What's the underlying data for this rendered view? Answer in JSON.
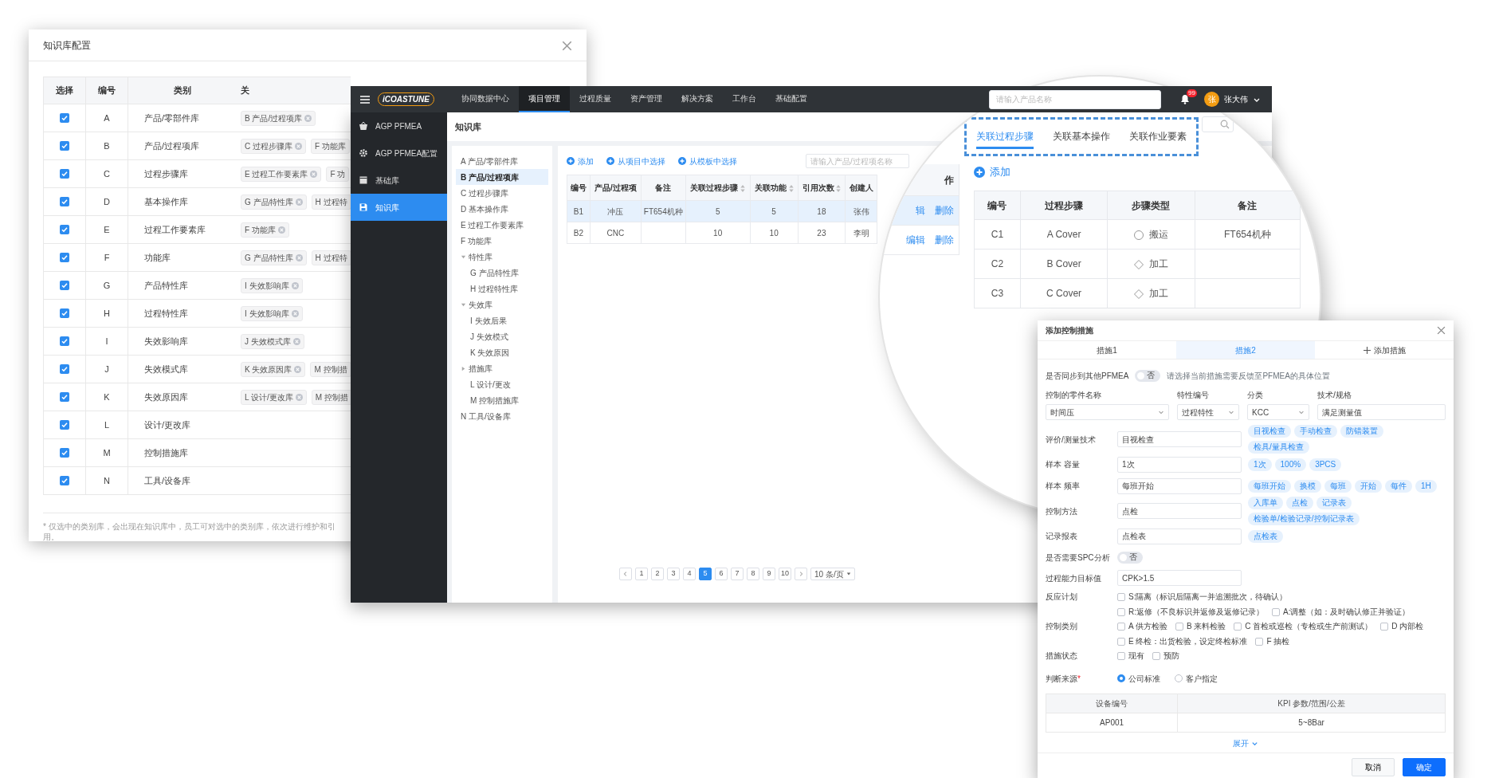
{
  "config_dialog": {
    "title": "知识库配置",
    "columns": [
      "选择",
      "编号",
      "类别",
      "关"
    ],
    "rows": [
      {
        "checked": true,
        "code": "A",
        "category": "产品/零部件库",
        "links": [
          {
            "label": "B 产品/过程项库",
            "removable": true
          }
        ]
      },
      {
        "checked": true,
        "code": "B",
        "category": "产品/过程项库",
        "links": [
          {
            "label": "C 过程步骤库",
            "removable": true
          },
          {
            "label": "F 功能库",
            "removable": false
          }
        ]
      },
      {
        "checked": true,
        "code": "C",
        "category": "过程步骤库",
        "links": [
          {
            "label": "E 过程工作要素库",
            "removable": true
          },
          {
            "label": "F 功",
            "removable": false
          }
        ]
      },
      {
        "checked": true,
        "code": "D",
        "category": "基本操作库",
        "links": [
          {
            "label": "G 产品特性库",
            "removable": true
          },
          {
            "label": "H 过程特",
            "removable": false
          }
        ]
      },
      {
        "checked": true,
        "code": "E",
        "category": "过程工作要素库",
        "links": [
          {
            "label": "F 功能库",
            "removable": true
          }
        ]
      },
      {
        "checked": true,
        "code": "F",
        "category": "功能库",
        "links": [
          {
            "label": "G 产品特性库",
            "removable": true
          },
          {
            "label": "H 过程特",
            "removable": false
          }
        ]
      },
      {
        "checked": true,
        "code": "G",
        "category": "产品特性库",
        "links": [
          {
            "label": "I 失效影响库",
            "removable": true
          }
        ]
      },
      {
        "checked": true,
        "code": "H",
        "category": "过程特性库",
        "links": [
          {
            "label": "I 失效影响库",
            "removable": true
          }
        ]
      },
      {
        "checked": true,
        "code": "I",
        "category": "失效影响库",
        "links": [
          {
            "label": "J 失效模式库",
            "removable": true
          }
        ]
      },
      {
        "checked": true,
        "code": "J",
        "category": "失效模式库",
        "links": [
          {
            "label": "K 失效原因库",
            "removable": true
          },
          {
            "label": "M 控制措",
            "removable": false
          }
        ]
      },
      {
        "checked": true,
        "code": "K",
        "category": "失效原因库",
        "links": [
          {
            "label": "L 设计/更改库",
            "removable": true
          },
          {
            "label": "M 控制措",
            "removable": false
          }
        ]
      },
      {
        "checked": true,
        "code": "L",
        "category": "设计/更改库"
      },
      {
        "checked": true,
        "code": "M",
        "category": "控制措施库"
      },
      {
        "checked": true,
        "code": "N",
        "category": "工具/设备库"
      }
    ],
    "footnote": "* 仅选中的类别库，会出现在知识库中，员工可对选中的类别库，依次进行维护和引用。"
  },
  "app": {
    "logo": "iCOASTUNE",
    "nav": [
      {
        "label": "协同数据中心",
        "selected": false
      },
      {
        "label": "项目管理",
        "selected": true
      },
      {
        "label": "过程质量",
        "selected": false
      },
      {
        "label": "资产管理",
        "selected": false
      },
      {
        "label": "解决方案",
        "selected": false
      },
      {
        "label": "工作台",
        "selected": false
      },
      {
        "label": "基础配置",
        "selected": false
      }
    ],
    "search": {
      "placeholder": "请输入产品名称"
    },
    "notifications": "99",
    "user": {
      "avatar": "张",
      "name": "张大伟"
    },
    "sidebar": [
      {
        "label": "AGP PFMEA",
        "selected": false
      },
      {
        "label": "AGP PFMEA配置",
        "selected": false
      },
      {
        "label": "基础库",
        "selected": false
      },
      {
        "label": "知识库",
        "selected": true
      }
    ],
    "page_title": "知识库",
    "tree": [
      {
        "label": "A 产品/零部件库",
        "selected": false
      },
      {
        "label": "B 产品/过程项库",
        "selected": true
      },
      {
        "label": "C 过程步骤库",
        "selected": false
      },
      {
        "label": "D 基本操作库",
        "selected": false
      },
      {
        "label": "E 过程工作要素库",
        "selected": false
      },
      {
        "label": "F 功能库",
        "selected": false
      },
      {
        "label": "特性库",
        "selected": false,
        "expanded": true,
        "children": [
          {
            "label": "G 产品特性库",
            "selected": false
          },
          {
            "label": "H 过程特性库",
            "selected": false
          }
        ]
      },
      {
        "label": "失效库",
        "selected": false,
        "expanded": true,
        "children": [
          {
            "label": "I 失效后果",
            "selected": false
          },
          {
            "label": "J 失效模式",
            "selected": false
          },
          {
            "label": "K 失效原因",
            "selected": false
          }
        ]
      },
      {
        "label": "措施库",
        "selected": false,
        "expanded": false,
        "children": [
          {
            "label": "L 设计/更改",
            "selected": false
          },
          {
            "label": "M 控制措施库",
            "selected": false
          }
        ]
      },
      {
        "label": "N 工具/设备库",
        "selected": false
      }
    ],
    "toolbar": [
      "添加",
      "从项目中选择",
      "从模板中选择"
    ],
    "table_search": {
      "placeholder": "请输入产品/过程项名称"
    },
    "table": {
      "columns": [
        {
          "label": "编号",
          "sortable": false
        },
        {
          "label": "产品/过程项",
          "sortable": false
        },
        {
          "label": "备注",
          "sortable": false
        },
        {
          "label": "关联过程步骤",
          "sortable": true
        },
        {
          "label": "关联功能",
          "sortable": true
        },
        {
          "label": "引用次数",
          "sortable": true
        },
        {
          "label": "创建人",
          "sortable": false
        }
      ],
      "rows": [
        {
          "selected": true,
          "cells": [
            "B1",
            "冲压",
            "FT654机种",
            "5",
            "5",
            "18",
            "张伟"
          ]
        },
        {
          "selected": false,
          "cells": [
            "B2",
            "CNC",
            "",
            "10",
            "10",
            "23",
            "李明"
          ]
        }
      ]
    },
    "pagination": {
      "pages": [
        {
          "label": "1",
          "selected": false
        },
        {
          "label": "2",
          "selected": false
        },
        {
          "label": "3",
          "selected": false
        },
        {
          "label": "4",
          "selected": false
        },
        {
          "label": "5",
          "selected": true
        },
        {
          "label": "6",
          "selected": false
        },
        {
          "label": "7",
          "selected": false
        },
        {
          "label": "8",
          "selected": false
        },
        {
          "label": "9",
          "selected": false
        },
        {
          "label": "10",
          "selected": false
        }
      ],
      "page_size": "10 条/页"
    }
  },
  "magnifier": {
    "left_table": {
      "header": "作",
      "rows": [
        [
          "辑",
          "删除"
        ],
        [
          "编辑",
          "删除"
        ]
      ]
    },
    "tabs": [
      {
        "label": "关联过程步骤",
        "selected": true
      },
      {
        "label": "关联基本操作",
        "selected": false
      },
      {
        "label": "关联作业要素",
        "selected": false
      }
    ],
    "add": "添加",
    "table": {
      "columns": [
        "编号",
        "过程步骤",
        "步骤类型",
        "备注"
      ],
      "rows": [
        {
          "code": "C1",
          "step": "A Cover",
          "type": {
            "kind": "circle",
            "label": "搬运"
          },
          "note": "FT654机种"
        },
        {
          "code": "C2",
          "step": "B Cover",
          "type": {
            "kind": "diamond",
            "label": "加工"
          }
        },
        {
          "code": "C3",
          "step": "C Cover",
          "type": {
            "kind": "diamond",
            "label": "加工"
          }
        }
      ]
    }
  },
  "control_dialog": {
    "title": "添加控制措施",
    "tabs": [
      {
        "label": "措施1",
        "selected": false
      },
      {
        "label": "措施2",
        "selected": true
      }
    ],
    "add_tab": "添加措施",
    "sync": {
      "label": "是否同步到其他PFMEA",
      "on": false,
      "switch_text": "否",
      "hint": "请选择当前措施需要反馈至PFMEA的具体位置"
    },
    "selects": [
      {
        "label": "控制的零件名称",
        "value": "时间压",
        "kind": "select"
      },
      {
        "label": "特性编号",
        "value": "过程特性",
        "kind": "select"
      },
      {
        "label": "分类",
        "value": "KCC",
        "kind": "select"
      },
      {
        "label": "技术/规格",
        "value": "满足测量值",
        "kind": "input"
      }
    ],
    "fields": [
      {
        "label": "评价/测量技术",
        "value": "目视检查",
        "chips": [
          "目视检查",
          "手动检查",
          "防错装置",
          "检具/量具检查"
        ]
      },
      {
        "label": "样本 容量",
        "value": "1次",
        "chips": [
          "1次",
          "100%",
          "3PCS"
        ]
      },
      {
        "label": "样本 频率",
        "value": "每班开始",
        "chips": [
          "每班开始",
          "换模",
          "每班",
          "开始",
          "每件",
          "1H"
        ]
      },
      {
        "label": "控制方法",
        "value": "点检",
        "chips": [
          "入库单",
          "点检",
          "记录表",
          "检验单/检验记录/控制记录表"
        ]
      },
      {
        "label": "记录报表",
        "value": "点检表",
        "chips": [
          "点检表"
        ]
      }
    ],
    "spc": {
      "label": "是否需要SPC分析",
      "on": false,
      "switch_text": "否"
    },
    "cpk": {
      "label": "过程能力目标值",
      "value": "CPK>1.5"
    },
    "reaction": {
      "label": "反应计划",
      "options": [
        {
          "label": "S:隔离（标识后隔离一并追溯批次，待确认）",
          "checked": false
        },
        {
          "label": "R:返修（不良标识并返修及返修记录）",
          "checked": false
        },
        {
          "label": "A:调整（如：及时确认修正并验证）",
          "checked": false
        }
      ]
    },
    "category": {
      "label": "控制类别",
      "options": [
        {
          "label": "A 供方检验",
          "checked": false
        },
        {
          "label": "B 来料检验",
          "checked": false
        },
        {
          "label": "C 首检或巡检（专检或生产前测试）",
          "checked": false
        },
        {
          "label": "D 内部检",
          "checked": false
        },
        {
          "label": "E 终检：出货检验，设定终检标准",
          "checked": false
        },
        {
          "label": "F 抽检",
          "checked": false
        }
      ]
    },
    "status": {
      "label": "措施状态",
      "options": [
        {
          "label": "现有",
          "checked": false
        },
        {
          "label": "预防",
          "checked": false
        }
      ]
    },
    "source": {
      "label": "判断来源",
      "required_mark": "*",
      "options": [
        {
          "label": "公司标准",
          "selected": true
        },
        {
          "label": "客户指定",
          "selected": false
        }
      ]
    },
    "equipment": {
      "columns": [
        "设备编号",
        "KPI 参数/范围/公差"
      ],
      "rows": [
        [
          "AP001",
          "5~8Bar"
        ]
      ]
    },
    "expand": "展开",
    "cancel": "取消",
    "confirm": "确定"
  }
}
